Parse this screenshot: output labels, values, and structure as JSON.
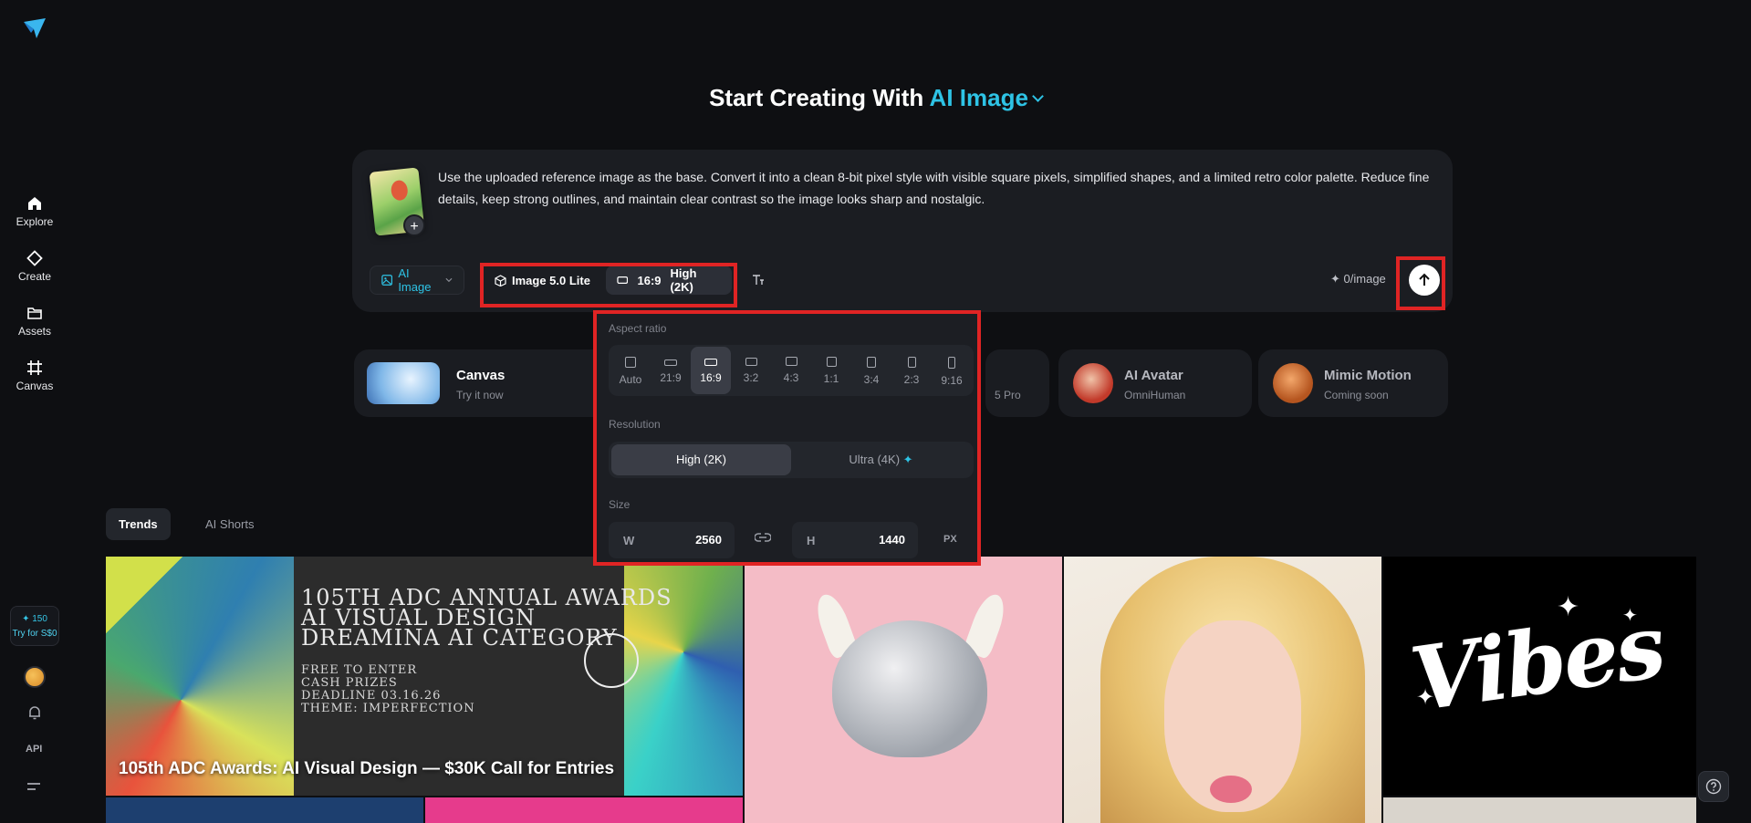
{
  "sidebar": {
    "items": [
      {
        "label": "Explore",
        "icon": "home-icon"
      },
      {
        "label": "Create",
        "icon": "diamond-icon"
      },
      {
        "label": "Assets",
        "icon": "folder-icon"
      },
      {
        "label": "Canvas",
        "icon": "canvas-icon"
      }
    ],
    "credits": "150",
    "try_label": "Try for S$0",
    "api_label": "API"
  },
  "heading": {
    "prefix": "Start Creating With ",
    "accent": "AI Image"
  },
  "prompt": {
    "text": "Use the uploaded reference image as the base. Convert it into a clean 8-bit pixel style with visible square pixels, simplified shapes, and a limited retro color palette. Reduce fine details, keep strong outlines, and maintain clear contrast so the image looks sharp and nostalgic.",
    "add_label": "+"
  },
  "toolbar": {
    "mode": "AI Image",
    "model": "Image 5.0 Lite",
    "ratio": "16:9",
    "resolution": "High (2K)",
    "cost": "0/image"
  },
  "features": [
    {
      "title": "Canvas",
      "subtitle": "Try it now"
    },
    {
      "title": "",
      "subtitle": "5 Pro"
    },
    {
      "title": "AI Avatar",
      "subtitle": "OmniHuman"
    },
    {
      "title": "Mimic Motion",
      "subtitle": "Coming soon"
    }
  ],
  "dropdown": {
    "aspect_label": "Aspect ratio",
    "ratios": [
      "Auto",
      "21:9",
      "16:9",
      "3:2",
      "4:3",
      "1:1",
      "3:4",
      "2:3",
      "9:16"
    ],
    "selected_ratio": "16:9",
    "resolution_label": "Resolution",
    "resolutions": [
      "High (2K)",
      "Ultra (4K)"
    ],
    "selected_resolution": "High (2K)",
    "size_label": "Size",
    "width_label": "W",
    "width": "2560",
    "height_label": "H",
    "height": "1440",
    "unit": "PX"
  },
  "tabs": [
    "Trends",
    "AI Shorts"
  ],
  "gallery": {
    "featured_caption": "105th ADC Awards: AI Visual Design — $30K Call for Entries",
    "featured_lines": [
      "105TH ADC ANNUAL AWARDS",
      "AI VISUAL DESIGN",
      "DREAMINA AI CATEGORY"
    ],
    "featured_small": [
      "FREE TO ENTER",
      "CASH PRIZES",
      "DEADLINE 03.16.26",
      "THEME: IMPERFECTION"
    ],
    "vibes_text": "Vibes"
  },
  "colors": {
    "accent": "#2ec3e5",
    "highlight": "#e02424",
    "background": "#0e0f12"
  }
}
